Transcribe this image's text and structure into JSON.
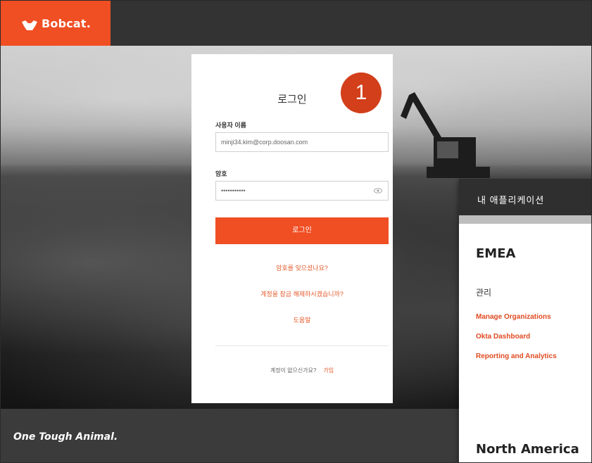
{
  "brand": {
    "logo_text": "Bobcat.",
    "tagline": "One Tough Animal."
  },
  "login": {
    "title": "로그인",
    "username_label": "사용자 이름",
    "username_value": "minji34.kim@corp.doosan.com",
    "password_label": "암호",
    "password_value": "•••••••••••",
    "login_button": "로그인",
    "forgot_password": "암호를 잊으셨나요?",
    "unlock_account": "계정을 잠금 해제하시겠습니까?",
    "help": "도움말",
    "no_account": "계정이 없으신가요?",
    "signup": "가입"
  },
  "annotation": {
    "step": "1"
  },
  "apps_panel": {
    "title": "내 애플리케이션",
    "region_emea": "EMEA",
    "admin_label": "관리",
    "links": [
      "Manage Organizations",
      "Okta Dashboard",
      "Reporting and Analytics"
    ],
    "region_na": "North America"
  },
  "colors": {
    "brand_orange": "#f04e23",
    "link_orange": "#e55a2b",
    "header_dark": "#333333"
  }
}
